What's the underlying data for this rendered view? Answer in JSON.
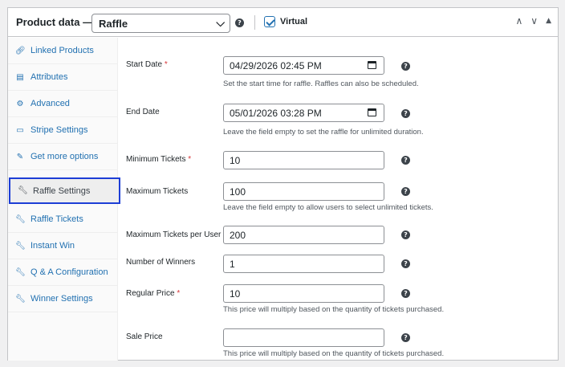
{
  "header": {
    "title": "Product data —",
    "product_type": "Raffle",
    "virtual_label": "Virtual",
    "virtual_checked": true
  },
  "tabs": [
    {
      "label": "Linked Products",
      "icon": "link-icon"
    },
    {
      "label": "Attributes",
      "icon": "list-icon"
    },
    {
      "label": "Advanced",
      "icon": "gear-icon"
    },
    {
      "label": "Stripe Settings",
      "icon": "card-icon"
    },
    {
      "label": "Get more options",
      "icon": "plugin-icon"
    },
    {
      "label": "Raffle Settings",
      "icon": "wrench-icon"
    },
    {
      "label": "Raffle Tickets",
      "icon": "wrench-icon"
    },
    {
      "label": "Instant Win",
      "icon": "wrench-icon"
    },
    {
      "label": "Q & A Configuration",
      "icon": "wrench-icon"
    },
    {
      "label": "Winner Settings",
      "icon": "wrench-icon"
    }
  ],
  "active_tab": "Raffle Settings",
  "fields": {
    "start_date": {
      "label": "Start Date",
      "required": "*",
      "value": "04/29/2026 02:45 PM",
      "desc": "Set the start time for raffle. Raffles can also be scheduled."
    },
    "end_date": {
      "label": "End Date",
      "value": "05/01/2026 03:28 PM",
      "desc": "Leave the field empty to set the raffle for unlimited duration."
    },
    "min_tickets": {
      "label": "Minimum Tickets",
      "required": "*",
      "value": "10"
    },
    "max_tickets": {
      "label": "Maximum Tickets",
      "value": "100",
      "desc": "Leave the field empty to allow users to select unlimited tickets."
    },
    "max_per_user": {
      "label": "Maximum Tickets per User",
      "value": "200"
    },
    "num_winners": {
      "label": "Number of Winners",
      "value": "1"
    },
    "regular_price": {
      "label": "Regular Price",
      "required": "*",
      "value": "10",
      "desc": "This price will multiply based on the quantity of tickets purchased."
    },
    "sale_price": {
      "label": "Sale Price",
      "value": "",
      "desc": "This price will multiply based on the quantity of tickets purchased."
    }
  },
  "colors": {
    "link": "#2271b1",
    "active_border": "#1d3ed6",
    "required": "#d63638"
  }
}
